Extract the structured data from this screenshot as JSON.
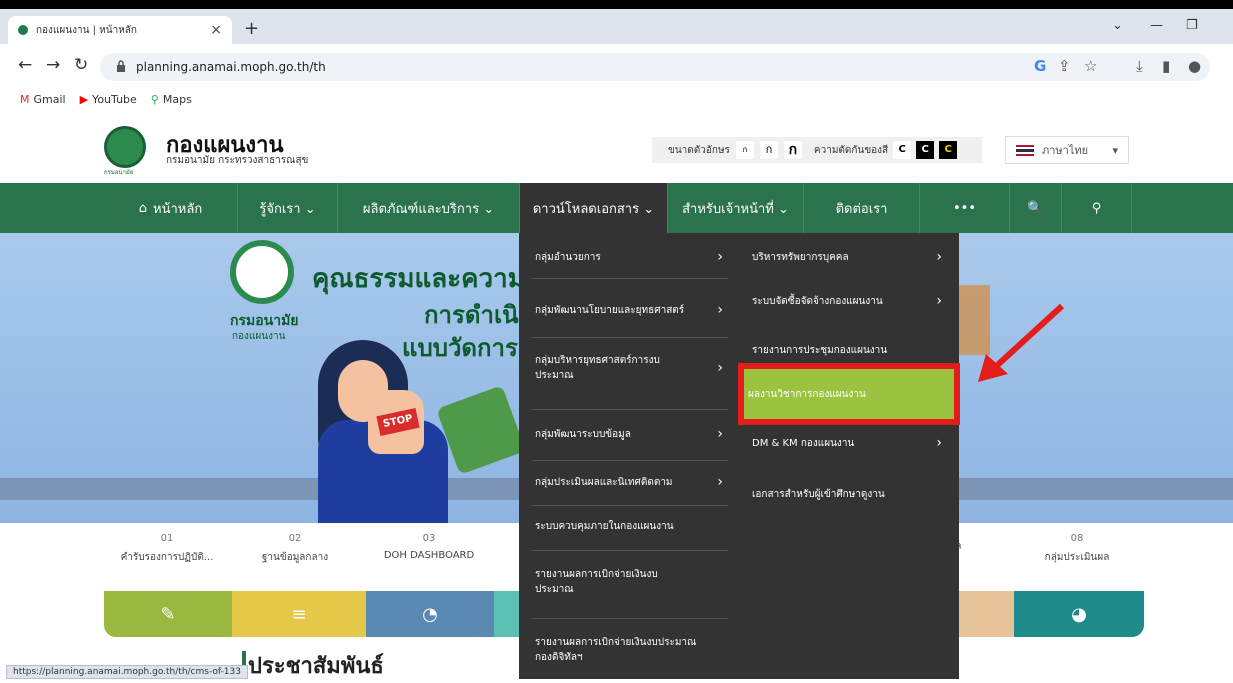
{
  "browser": {
    "tab_title": "กองแผนงาน | หน้าหลัก",
    "tab_close": "×",
    "new_tab": "+",
    "url": "planning.anamai.moph.go.th/th",
    "status_url": "https://planning.anamai.moph.go.th/th/cms-of-133",
    "bookmarks": [
      {
        "label": "Gmail",
        "icon": "gmail-icon"
      },
      {
        "label": "YouTube",
        "icon": "youtube-icon"
      },
      {
        "label": "Maps",
        "icon": "maps-icon"
      }
    ]
  },
  "site": {
    "title": "กองแผนงาน",
    "subtitle": "กรมอนามัย กระทรวงสาธารณสุข",
    "logo_caption": "กรมอนามัย",
    "font_size_label": "ขนาดตัวอักษร",
    "font_sizes": [
      "ก",
      "ก",
      "ก"
    ],
    "contrast_label": "ความตัดกันของสี",
    "contrast_options": [
      "C",
      "C",
      "C"
    ],
    "language": "ภาษาไทย"
  },
  "nav": [
    {
      "label": "หน้าหลัก",
      "icon": "home-icon"
    },
    {
      "label": "รู้จักเรา ⌄"
    },
    {
      "label": "ผลิตภัณฑ์และบริการ ⌄"
    },
    {
      "label": "ดาวน์โหลดเอกสาร ⌄"
    },
    {
      "label": "สำหรับเจ้าหน้าที่ ⌄"
    },
    {
      "label": "ติดต่อเรา"
    },
    {
      "label": "•••"
    },
    {
      "label": "🔍"
    },
    {
      "label": "⚲"
    }
  ],
  "hero": {
    "title": "คุณธรรมและความโ",
    "sub1": "การดำเนิน",
    "sub2": "แบบวัดการเปิ",
    "logo_title": "กรมอนามัย",
    "logo_sub": "กองแผนงาน",
    "stop_text": "STOP"
  },
  "dropdown": {
    "left": [
      {
        "label": "กลุ่มอำนวยการ",
        "arrow": true
      },
      {
        "label": "กลุ่มพัฒนานโยบายและยุทธศาสตร์",
        "arrow": true
      },
      {
        "label": "กลุ่มบริหารยุทธศาสตร์การงบประมาณ",
        "arrow": true
      },
      {
        "label": "กลุ่มพัฒนาระบบข้อมูล",
        "arrow": true
      },
      {
        "label": "กลุ่มประเมินผลและนิเทศติดตาม",
        "arrow": true
      },
      {
        "label": "ระบบควบคุมภายในกองแผนงาน",
        "arrow": false
      },
      {
        "label": "รายงานผลการเบิกจ่ายเงินงบประมาณ",
        "arrow": false
      },
      {
        "label": "รายงานผลการเบิกจ่ายเงินงบประมาณ กองดิจิทัลฯ",
        "arrow": false
      }
    ],
    "right": [
      {
        "label": "บริหารทรัพยากรบุคคล",
        "arrow": true
      },
      {
        "label": "ระบบจัดซื้อจัดจ้างกองแผนงาน",
        "arrow": true
      },
      {
        "label": "รายงานการประชุมกองแผนงาน",
        "arrow": false
      },
      {
        "label": "ผลงานวิชาการกองแผนงาน",
        "arrow": false
      },
      {
        "label": "DM & KM กองแผนงาน",
        "arrow": true
      },
      {
        "label": "เอกสารสำหรับผู้เข้าศึกษาดูงาน",
        "arrow": false
      }
    ]
  },
  "quick": [
    {
      "num": "01",
      "label": "คำรับรองการปฏิบัติ..."
    },
    {
      "num": "02",
      "label": "ฐานข้อมูลกลาง"
    },
    {
      "num": "03",
      "label": "DOH DASHBOARD"
    },
    {
      "num": "",
      "label": "มูล"
    },
    {
      "num": "08",
      "label": "กลุ่มประเมินผล"
    }
  ],
  "categories": {
    "colors": [
      "#9ab840",
      "#e5c848",
      "#5a8ab4",
      "#5dc0b4",
      "#e7c49a",
      "#1e8a8a"
    ],
    "icons": [
      "✎",
      "≡",
      "◔",
      "",
      "",
      "◕"
    ]
  },
  "section": {
    "title": "ประชาสัมพันธ์"
  }
}
